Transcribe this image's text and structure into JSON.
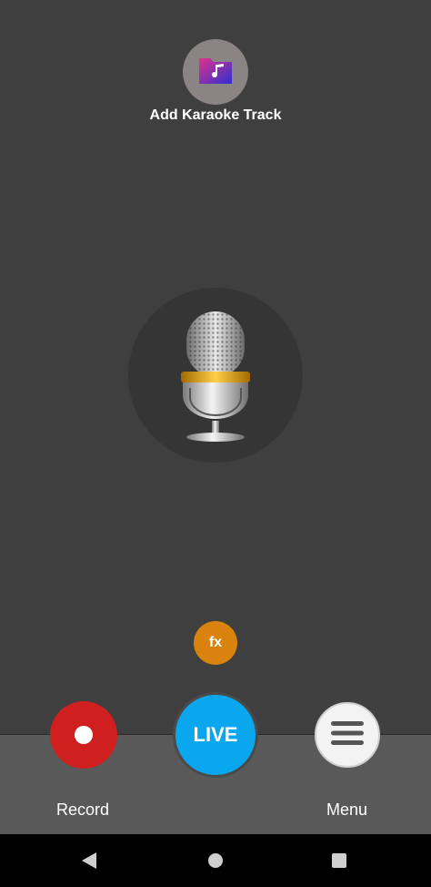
{
  "karaoke": {
    "label": "Add Karaoke Track",
    "icon": "music-folder-icon"
  },
  "mic": {
    "icon": "microphone-icon"
  },
  "fx": {
    "label": "fx"
  },
  "controls": {
    "record_label": "Record",
    "live_label": "LIVE",
    "menu_label": "Menu"
  },
  "colors": {
    "background": "#3f3f3f",
    "record": "#cf1f1f",
    "live": "#0aa6ee",
    "fx": "#d9820e"
  },
  "nav": {
    "back": "back-icon",
    "home": "home-icon",
    "recents": "recents-icon"
  }
}
